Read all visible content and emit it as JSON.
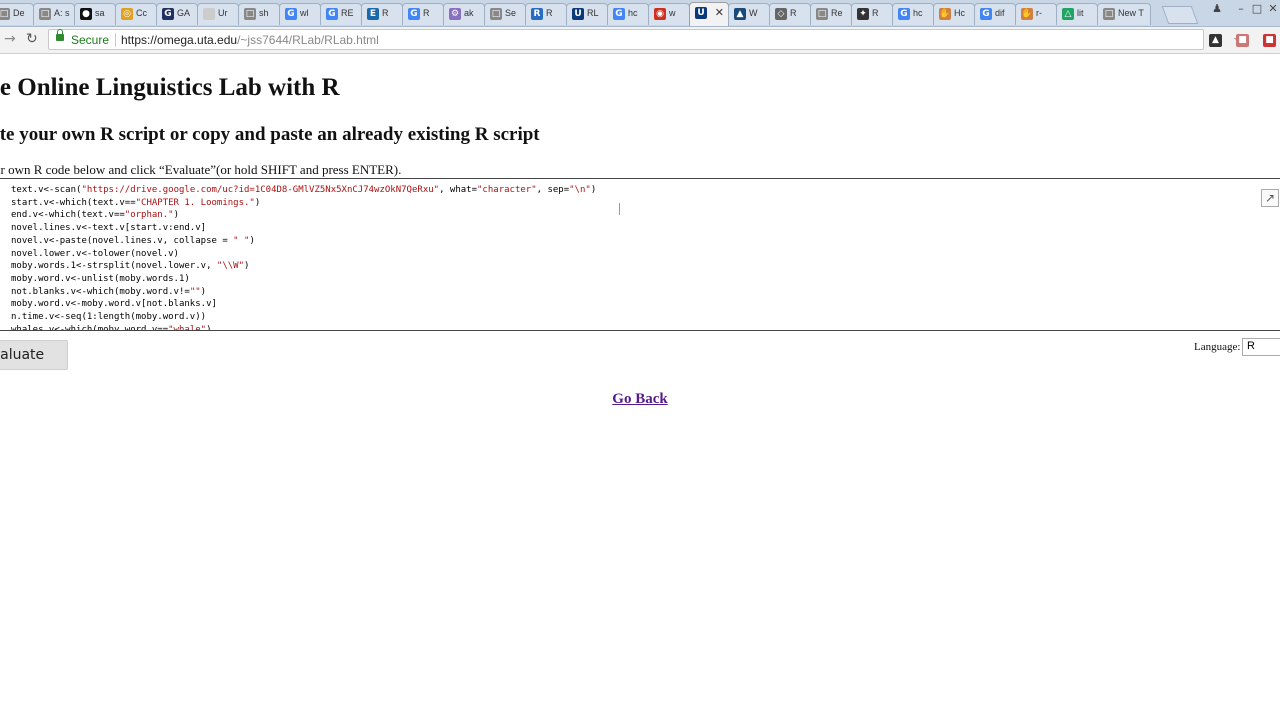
{
  "browser": {
    "tabs": [
      {
        "label": "De",
        "icon": "page-icon",
        "color": "#888888",
        "active": false
      },
      {
        "label": "A: s",
        "icon": "page-icon",
        "color": "#888888",
        "active": false
      },
      {
        "label": "sa",
        "icon": "github-icon",
        "color": "#111111",
        "active": false
      },
      {
        "label": "Cc",
        "icon": "chrome-icon",
        "color": "#e0a020",
        "active": false
      },
      {
        "label": "GA",
        "icon": "ga-icon",
        "color": "#203060",
        "active": false
      },
      {
        "label": "Ur",
        "icon": "blank-icon",
        "color": "#cccccc",
        "active": false
      },
      {
        "label": "sh",
        "icon": "page-icon",
        "color": "#888888",
        "active": false
      },
      {
        "label": "wl",
        "icon": "google-icon",
        "color": "#4285f4",
        "active": false
      },
      {
        "label": "RE",
        "icon": "google-icon",
        "color": "#4285f4",
        "active": false
      },
      {
        "label": "R",
        "icon": "em-icon",
        "color": "#1a6aa8",
        "active": false
      },
      {
        "label": "R",
        "icon": "google-icon",
        "color": "#4285f4",
        "active": false
      },
      {
        "label": "ak",
        "icon": "gear-icon",
        "color": "#8870c0",
        "active": false
      },
      {
        "label": "Se",
        "icon": "page-icon",
        "color": "#888888",
        "active": false
      },
      {
        "label": "R",
        "icon": "r-icon",
        "color": "#276dc3",
        "active": false
      },
      {
        "label": "RL",
        "icon": "uta-icon",
        "color": "#0a3a7a",
        "active": false
      },
      {
        "label": "hc",
        "icon": "google-icon",
        "color": "#4285f4",
        "active": false
      },
      {
        "label": "w",
        "icon": "red-icon",
        "color": "#d03020",
        "active": false
      },
      {
        "label": "",
        "icon": "uta-icon",
        "color": "#0a3a7a",
        "active": true
      },
      {
        "label": "W",
        "icon": "bird-icon",
        "color": "#1a4a7a",
        "active": false
      },
      {
        "label": "R",
        "icon": "diamond-icon",
        "color": "#666666",
        "active": false
      },
      {
        "label": "Re",
        "icon": "page-icon",
        "color": "#888888",
        "active": false
      },
      {
        "label": "R",
        "icon": "puzzle-icon",
        "color": "#333333",
        "active": false
      },
      {
        "label": "hc",
        "icon": "google-icon",
        "color": "#4285f4",
        "active": false
      },
      {
        "label": "Hc",
        "icon": "hand-icon",
        "color": "#d08040",
        "active": false
      },
      {
        "label": "dif",
        "icon": "google-icon",
        "color": "#4285f4",
        "active": false
      },
      {
        "label": "r-",
        "icon": "hand-icon",
        "color": "#d08040",
        "active": false
      },
      {
        "label": "lit",
        "icon": "drive-icon",
        "color": "#1fa463",
        "active": false
      },
      {
        "label": "New T",
        "icon": "page-icon",
        "color": "#888888",
        "active": false
      }
    ],
    "secure_label": "Secure",
    "url_host": "https://omega.uta.edu",
    "url_path": "/~jss7644/RLab/RLab.html"
  },
  "page": {
    "title": "he Online Linguistics Lab with R",
    "subtitle": "rite your own R script or copy and paste an already existing R script",
    "instructions": "e your own R code below and click “Evaluate”(or hold SHIFT and press ENTER).",
    "code_lines": [
      "text.v<-scan(\"https://drive.google.com/uc?id=1C04D8-GMlVZ5Nx5XnCJ74wzOkN7QeRxu\", what=\"character\", sep=\"\\n\")",
      "start.v<-which(text.v==\"CHAPTER 1. Loomings.\")",
      "end.v<-which(text.v==\"orphan.\")",
      "novel.lines.v<-text.v[start.v:end.v]",
      "novel.v<-paste(novel.lines.v, collapse = \" \")",
      "novel.lower.v<-tolower(novel.v)",
      "moby.words.1<-strsplit(novel.lower.v, \"\\\\W\")",
      "moby.word.v<-unlist(moby.words.1)",
      "not.blanks.v<-which(moby.word.v!=\"\")",
      "moby.word.v<-moby.word.v[not.blanks.v]",
      "n.time.v<-seq(1:length(moby.word.v))",
      "whales.v<-which(moby.word.v==\"whale\")"
    ],
    "evaluate_label": "Evaluate",
    "language_label": "Language:",
    "language_value": "R",
    "go_back_label": "Go Back"
  }
}
